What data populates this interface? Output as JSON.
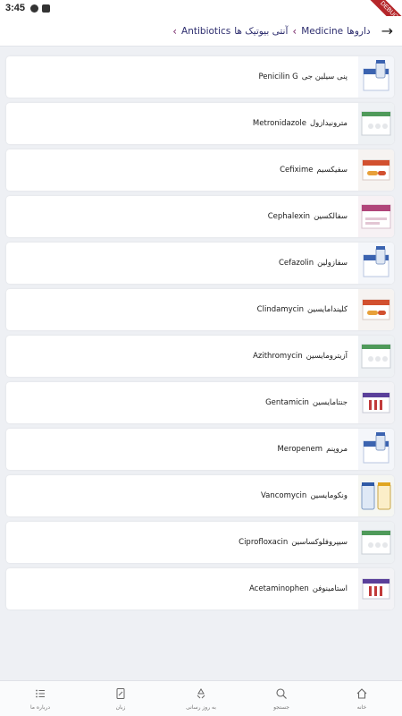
{
  "status_bar": {
    "time": "3:45",
    "debug_label": "DEBUG"
  },
  "breadcrumb": {
    "items": [
      "داروها",
      "Medicine",
      "آنتی بیوتیک ها",
      "Antibiotics"
    ]
  },
  "drugs": [
    {
      "fa": "پنی سیلین جی",
      "en": "Penicilin G",
      "icon": "vial-box-icon"
    },
    {
      "fa": "مترونیدازول",
      "en": "Metronidazole",
      "icon": "tablet-box-icon"
    },
    {
      "fa": "سفیکسیم",
      "en": "Cefixime",
      "icon": "capsule-box-icon"
    },
    {
      "fa": "سفالکسین",
      "en": "Cephalexin",
      "icon": "pill-box-icon"
    },
    {
      "fa": "سفازولین",
      "en": "Cefazolin",
      "icon": "vial-box-icon"
    },
    {
      "fa": "کلیندامایسین",
      "en": "Clindamycin",
      "icon": "capsule-box-icon"
    },
    {
      "fa": "آزیترومایسین",
      "en": "Azithromycin",
      "icon": "tablet-box-icon"
    },
    {
      "fa": "جنتامایسین",
      "en": "Gentamicin",
      "icon": "ampoule-box-icon"
    },
    {
      "fa": "مروپنم",
      "en": "Meropenem",
      "icon": "vial-box-icon"
    },
    {
      "fa": "ونکومایسین",
      "en": "Vancomycin",
      "icon": "vial-bottle-icon"
    },
    {
      "fa": "سیپروفلوکساسین",
      "en": "Ciprofloxacin",
      "icon": "tablet-box-icon"
    },
    {
      "fa": "استامینوفن",
      "en": "Acetaminophen",
      "icon": "ampoule-box-icon"
    }
  ],
  "bottom_nav": [
    {
      "label": "خانه",
      "icon": "home-icon"
    },
    {
      "label": "جستجو",
      "icon": "search-icon"
    },
    {
      "label": "به روز رسانی",
      "icon": "recycle-icon"
    },
    {
      "label": "زبان",
      "icon": "language-icon"
    },
    {
      "label": "درباره ما",
      "icon": "about-list-icon"
    }
  ],
  "colors": {
    "background": "#eef0f4",
    "card": "#ffffff",
    "breadcrumb_text": "#2d2d6e",
    "breadcrumb_separator": "#7b2d6e",
    "debug_ribbon": "#b5262a"
  }
}
